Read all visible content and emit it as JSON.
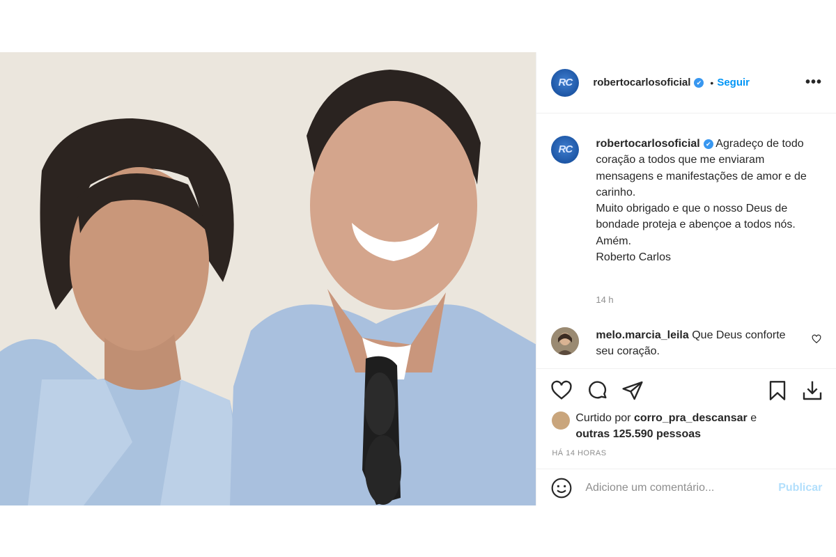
{
  "account": {
    "username": "robertocarlosoficial",
    "follow_label": "Seguir",
    "separator": "•",
    "more_label": "•••",
    "avatar_mono": "RC"
  },
  "caption": {
    "username": "robertocarlosoficial",
    "line1": "Agradeço de todo coração a todos que me enviaram mensagens e manifestações de amor e de carinho.",
    "line2": "Muito obrigado e que o nosso Deus de bondade proteja e abençoe a todos nós.",
    "line3": "Amém.",
    "line4": "Roberto Carlos",
    "time": "14 h"
  },
  "comment": {
    "username": "melo.marcia_leila",
    "text": "Que Deus conforte seu coração."
  },
  "likes": {
    "prefix": "Curtido por",
    "user": "corro_pra_descansar",
    "connector": "e",
    "others": "outras 125.590 pessoas"
  },
  "posted_ago": "HÁ 14 HORAS",
  "add_comment": {
    "placeholder": "Adicione um comentário...",
    "publish_label": "Publicar"
  },
  "icons": [
    "heart-icon",
    "comment-icon",
    "share-icon",
    "bookmark-icon",
    "download-icon",
    "emoji-icon",
    "verified-icon"
  ],
  "colors": {
    "link": "#0095f6",
    "publish_disabled": "#b2dffc",
    "muted": "#8e8e8e",
    "text": "#262626"
  }
}
